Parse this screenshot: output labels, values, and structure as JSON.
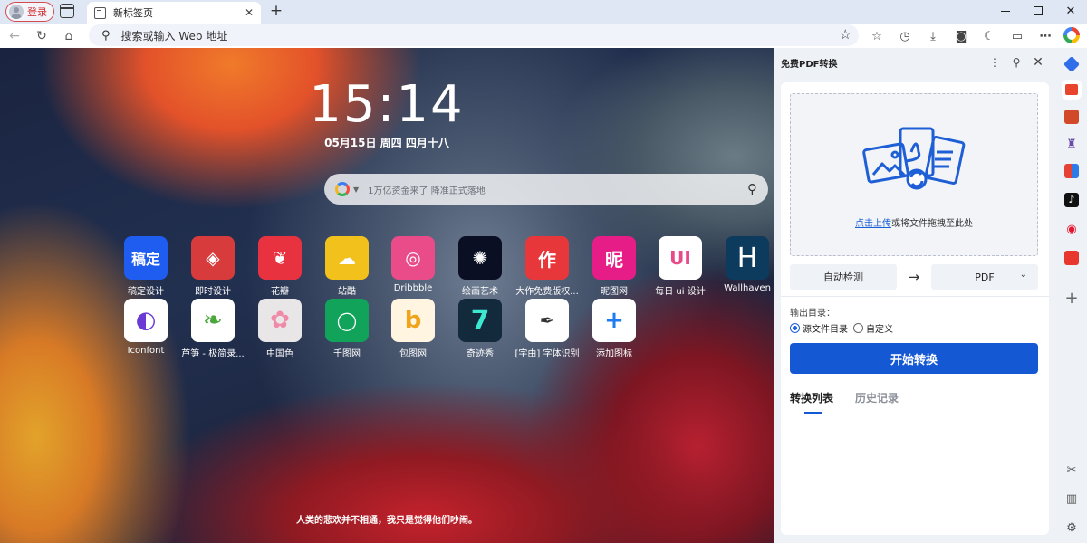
{
  "browser": {
    "login_label": "登录",
    "tab_title": "新标签页",
    "tab_close": "✕",
    "new_tab": "+",
    "address_placeholder": "搜索或输入 Web 地址"
  },
  "ntp": {
    "time": "15:14",
    "date": "05月15日 周四 四月十八",
    "search_placeholder": "1万亿资金来了 降准正式落地",
    "apps": [
      {
        "label": "稿定设计",
        "glyph": "稿定",
        "color": "#1f5cf0"
      },
      {
        "label": "即时设计",
        "glyph": "◈",
        "color": "#d83b3b"
      },
      {
        "label": "花瓣",
        "glyph": "❦",
        "color": "#e8323f"
      },
      {
        "label": "站酷",
        "glyph": "☁",
        "color": "#f2c11c"
      },
      {
        "label": "Dribbble",
        "glyph": "◎",
        "color": "#ea4c89"
      },
      {
        "label": "绘画艺术",
        "glyph": "✺",
        "color": "#0b0f24"
      },
      {
        "label": "大作免费版权...",
        "glyph": "作",
        "color": "#e8373a"
      },
      {
        "label": "昵图网",
        "glyph": "昵",
        "color": "#e61d86"
      },
      {
        "label": "每日 ui 设计",
        "glyph": "UI",
        "color": "#ffffff"
      },
      {
        "label": "Wallhaven",
        "glyph": "H",
        "color": "#0d3b5e"
      },
      {
        "label": "Iconfont",
        "glyph": "◐",
        "color": "#ffffff"
      },
      {
        "label": "芦笋 - 极简录...",
        "glyph": "❧",
        "color": "#ffffff"
      },
      {
        "label": "中国色",
        "glyph": "✿",
        "color": "#e8e6e6"
      },
      {
        "label": "千图网",
        "glyph": "◯",
        "color": "#11a35a"
      },
      {
        "label": "包图网",
        "glyph": "b",
        "color": "#fff5e0"
      },
      {
        "label": "奇迹秀",
        "glyph": "7",
        "color": "#132a3c"
      },
      {
        "label": "[字由] 字体识别",
        "glyph": "✒",
        "color": "#ffffff"
      },
      {
        "label": "添加图标",
        "glyph": "+",
        "color": "#ffffff"
      }
    ],
    "quote": "人类的悲欢并不相通，我只是觉得他们吵闹。"
  },
  "panel": {
    "title": "免费PDF转换",
    "upload_link": "点击上传",
    "upload_text": "或将文件拖拽至此处",
    "source_format": "自动检测",
    "target_format": "PDF",
    "output_label": "输出目录：",
    "radio_source": "源文件目录",
    "radio_custom": "自定义",
    "start_button": "开始转换",
    "tab_list": "转换列表",
    "tab_history": "历史记录"
  }
}
